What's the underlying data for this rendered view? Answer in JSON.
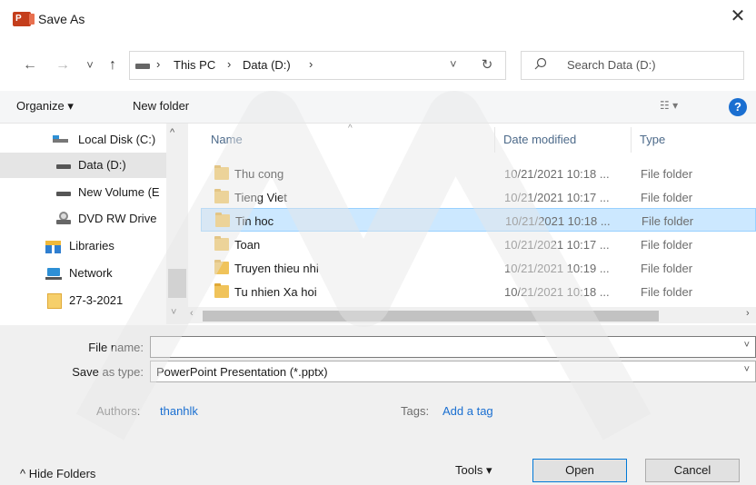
{
  "window": {
    "title": "Save As",
    "app_icon_letter": "P",
    "close_glyph": "✕"
  },
  "nav": {
    "back": "←",
    "forward": "→",
    "history": "˅",
    "up": "↑",
    "breadcrumbs": [
      "This PC",
      "Data (D:)"
    ],
    "sep": "›",
    "address_dropdown": "˅",
    "refresh": "↻",
    "search_placeholder": "Search Data (D:)"
  },
  "toolbar": {
    "organize": "Organize ▾",
    "new_folder": "New folder",
    "view": "☷ ▾",
    "help": "?"
  },
  "sidebar": {
    "items": [
      {
        "label": "Local Disk (C:)",
        "icon": "local-disk-icon"
      },
      {
        "label": "Data (D:)",
        "icon": "drive-icon",
        "selected": true
      },
      {
        "label": "New Volume (E",
        "icon": "drive-icon"
      },
      {
        "label": "DVD RW Drive",
        "icon": "dvd-icon"
      },
      {
        "label": "Libraries",
        "icon": "libraries-icon"
      },
      {
        "label": "Network",
        "icon": "network-icon"
      },
      {
        "label": "27-3-2021",
        "icon": "folder-icon"
      }
    ],
    "scroll_up": "^",
    "scroll_down": "˅"
  },
  "files": {
    "columns": [
      "Name",
      "Date modified",
      "Type"
    ],
    "rows": [
      {
        "name": "Thu cong",
        "date": "10/21/2021 10:18 ...",
        "type": "File folder"
      },
      {
        "name": "Tieng Viet",
        "date": "10/21/2021 10:17 ...",
        "type": "File folder"
      },
      {
        "name": "Tin hoc",
        "date": "10/21/2021 10:18 ...",
        "type": "File folder",
        "selected": true
      },
      {
        "name": "Toan",
        "date": "10/21/2021 10:17 ...",
        "type": "File folder"
      },
      {
        "name": "Truyen thieu nhi",
        "date": "10/21/2021 10:19 ...",
        "type": "File folder"
      },
      {
        "name": "Tu nhien Xa hoi",
        "date": "10/21/2021 10:18 ...",
        "type": "File folder"
      }
    ],
    "scroll_left": "‹",
    "scroll_right": "›"
  },
  "form": {
    "file_name_label": "File name:",
    "file_name_value": "",
    "save_type_label": "Save as type:",
    "save_type_value": "PowerPoint Presentation (*.pptx)",
    "caret": "˅",
    "authors_label": "Authors:",
    "authors_value": "thanhlk",
    "tags_label": "Tags:",
    "tags_value": "Add a tag"
  },
  "footer": {
    "hide_folders": "^  Hide Folders",
    "tools": "Tools   ▾",
    "open": "Open",
    "cancel": "Cancel"
  },
  "colors": {
    "accent": "#0078d7",
    "selection": "#cce8ff",
    "link": "#1a6fd1"
  }
}
